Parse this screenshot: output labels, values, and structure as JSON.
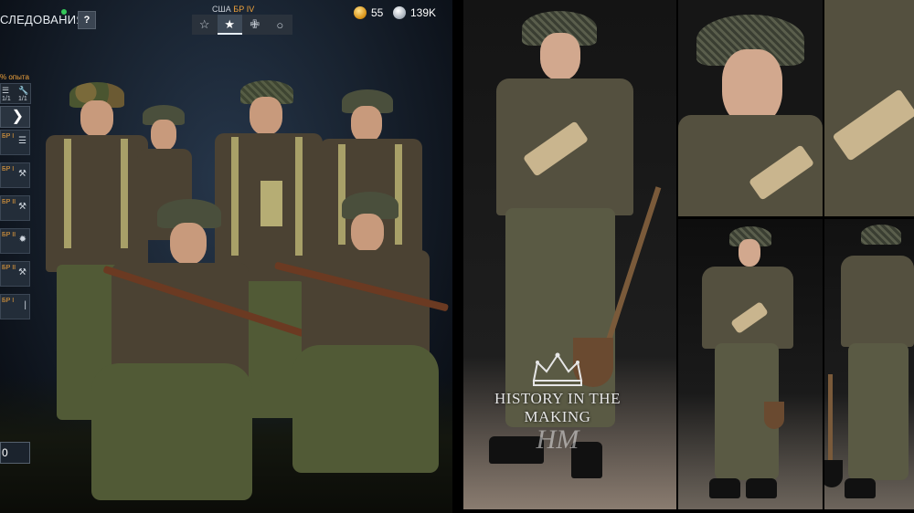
{
  "game": {
    "title": "СЛЕДОВАНИЯ",
    "help_label": "?",
    "nation": "США",
    "battle_rating": "БР IV",
    "rank_tabs": [
      "☆",
      "★",
      "✙",
      "○"
    ],
    "active_tab_index": 1,
    "currency": {
      "gold": "55",
      "silver": "139K"
    },
    "side_panel": {
      "exp_label": "% опыта",
      "counter_a": "1/1",
      "counter_b": "1/1",
      "arrow": "❯",
      "rows": [
        {
          "label": "БР I",
          "icon": "list-icon"
        },
        {
          "label": "БР I",
          "icon": "wrench-icon"
        },
        {
          "label": "БР II",
          "icon": "wrench-icon"
        },
        {
          "label": "БР II",
          "icon": "flame-icon"
        },
        {
          "label": "БР II",
          "icon": "wrench-icon"
        },
        {
          "label": "БР I",
          "icon": "knife-icon"
        }
      ],
      "bottom_label": "0"
    }
  },
  "photos": {
    "watermark_title": "HISTORY IN THE MAKING",
    "watermark_monogram": "HM"
  },
  "colors": {
    "accent_orange": "#f0a33c",
    "online_green": "#34c759",
    "panel_bg": "#232d39"
  }
}
